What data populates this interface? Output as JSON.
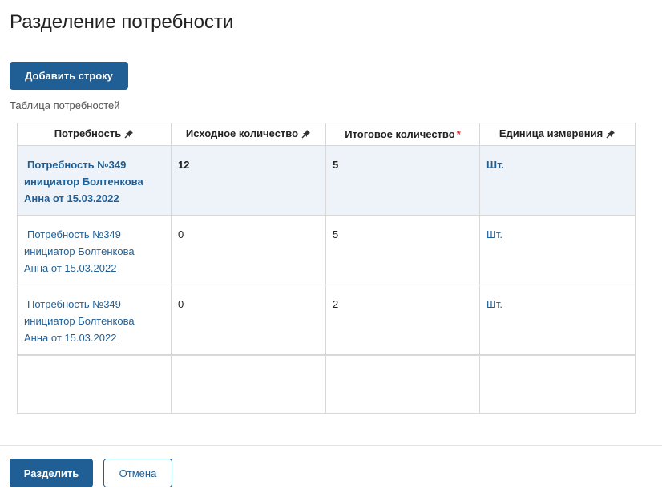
{
  "dialog": {
    "title": "Разделение потребности",
    "add_row_label": "Добавить строку",
    "table_caption": "Таблица потребностей",
    "split_label": "Разделить",
    "cancel_label": "Отмена"
  },
  "table": {
    "columns": [
      {
        "label": "Потребность",
        "pinned": true,
        "required": false
      },
      {
        "label": "Исходное количество",
        "pinned": true,
        "required": false
      },
      {
        "label": "Итоговое количество",
        "pinned": false,
        "required": true,
        "required_mark": "*"
      },
      {
        "label": "Единица измерения",
        "pinned": true,
        "required": false
      }
    ],
    "rows": [
      {
        "need_line1": "Потребность №349",
        "need_line2": "инициатор Болтенкова",
        "need_line3": "Анна от 15.03.2022",
        "initial_qty": "12",
        "final_qty": "5",
        "unit": "Шт.",
        "selected": true
      },
      {
        "need_line1": "Потребность №349",
        "need_line2": "инициатор Болтенкова",
        "need_line3": "Анна от 15.03.2022",
        "initial_qty": "0",
        "final_qty": "5",
        "unit": "Шт.",
        "selected": false
      },
      {
        "need_line1": "Потребность №349",
        "need_line2": "инициатор Болтенкова",
        "need_line3": "Анна от 15.03.2022",
        "initial_qty": "0",
        "final_qty": "2",
        "unit": "Шт.",
        "selected": false
      }
    ]
  },
  "colors": {
    "primary": "#1f5f96",
    "selected_row": "#eef3f9",
    "required": "#d32f2f"
  },
  "icons": {
    "pin": "pin-icon"
  }
}
